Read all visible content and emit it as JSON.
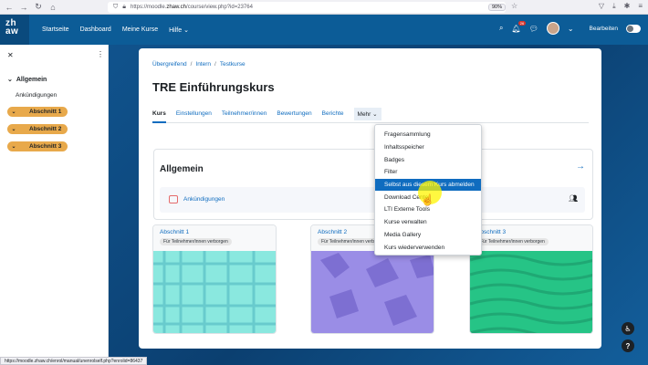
{
  "browser": {
    "url_prefix": "https://moodle.",
    "url_domain": "zhaw.ch",
    "url_path": "/course/view.php?id=23764",
    "zoom": "90%",
    "status_url": "https://moodle.zhaw.ch/enrol/manual/unenrolself.php?enrolid=86437"
  },
  "navbar": {
    "logo_top": "zh",
    "logo_bottom": "aw",
    "links": [
      "Startseite",
      "Dashboard",
      "Meine Kurse",
      "Hilfe"
    ],
    "notification_count": "26",
    "edit_mode_label": "Bearbeiten"
  },
  "drawer": {
    "general_label": "Allgemein",
    "announcements_label": "Ankündigungen",
    "sections": [
      "Abschnitt 1",
      "Abschnitt 2",
      "Abschnitt 3"
    ]
  },
  "course": {
    "breadcrumb": [
      "Übergreifend",
      "Intern",
      "Testkurse"
    ],
    "title": "TRE Einführungskurs",
    "tabs": [
      "Kurs",
      "Einstellungen",
      "Teilnehmer/innen",
      "Bewertungen",
      "Berichte",
      "Mehr"
    ],
    "general_title": "Allgemein",
    "announcements": "Ankündigungen",
    "sections": [
      {
        "name": "Abschnitt 1",
        "badge": "Für Teilnehmer/innen verborgen"
      },
      {
        "name": "Abschnitt 2",
        "badge": "Für Teilnehmer/innen verborgen"
      },
      {
        "name": "Abschnitt 3",
        "badge": "Für Teilnehmer/innen verborgen"
      }
    ]
  },
  "more_menu": {
    "items": [
      "Fragensammlung",
      "Inhaltsspeicher",
      "Badges",
      "Filter",
      "Selbst aus diesem Kurs abmelden",
      "Download Center",
      "LTI Externe Tools",
      "Kurse verwalten",
      "Media Gallery",
      "Kurs wiederverwenden"
    ],
    "active_index": 4
  },
  "colors": {
    "navbar": "#0c5c97",
    "accent": "#0f6cbf",
    "section_pill": "#e8a94b"
  }
}
